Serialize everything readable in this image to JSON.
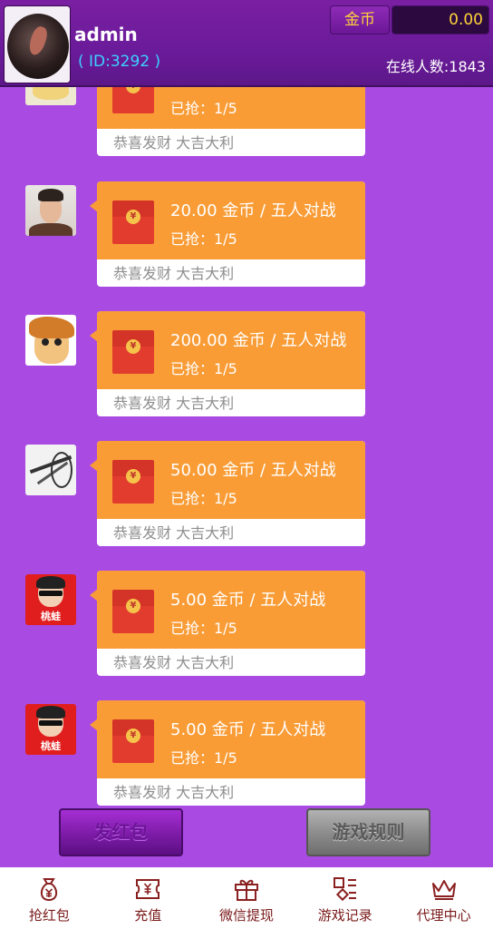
{
  "header": {
    "username": "admin",
    "user_id": "( ID:3292 )",
    "coin_label": "金币",
    "coin_value": "0.00",
    "online_text": "在线人数:1843"
  },
  "envelope_seal": "¥",
  "messages": [
    {
      "avatar": "partial-avatar",
      "amount_text": "",
      "grabbed_text": "已抢：1/5",
      "blessing": "恭喜发财 大吉大利"
    },
    {
      "avatar": "man-photo-avatar",
      "amount_text": "20.00 金币 / 五人对战",
      "grabbed_text": "已抢：1/5",
      "blessing": "恭喜发财 大吉大利"
    },
    {
      "avatar": "cartoon-avatar",
      "amount_text": "200.00 金币 / 五人对战",
      "grabbed_text": "已抢：1/5",
      "blessing": "恭喜发财 大吉大利"
    },
    {
      "avatar": "sketch-avatar",
      "amount_text": "50.00 金币 / 五人对战",
      "grabbed_text": "已抢：1/5",
      "blessing": "恭喜发财 大吉大利"
    },
    {
      "avatar": "red-cartoon-avatar",
      "avatar_tag": "桃蛙",
      "amount_text": "5.00 金币 / 五人对战",
      "grabbed_text": "已抢：1/5",
      "blessing": "恭喜发财 大吉大利"
    },
    {
      "avatar": "red-cartoon-avatar",
      "avatar_tag": "桃蛙",
      "amount_text": "5.00 金币 / 五人对战",
      "grabbed_text": "已抢：1/5",
      "blessing": "恭喜发财 大吉大利"
    }
  ],
  "actions": {
    "send_label": "发红包",
    "rules_label": "游戏规则"
  },
  "nav": [
    {
      "label": "抢红包",
      "icon": "money-bag-icon"
    },
    {
      "label": "充值",
      "icon": "ticket-yen-icon"
    },
    {
      "label": "微信提现",
      "icon": "gift-box-icon"
    },
    {
      "label": "游戏记录",
      "icon": "grid-list-icon"
    },
    {
      "label": "代理中心",
      "icon": "crown-icon"
    }
  ],
  "colors": {
    "background": "#a94be3",
    "header": "#6a1b9a",
    "bubble": "#f99c36",
    "envelope": "#e23c2f",
    "coin_text": "#ffd23a",
    "id_text": "#3ed0ff",
    "nav_text": "#7a1a1a"
  }
}
